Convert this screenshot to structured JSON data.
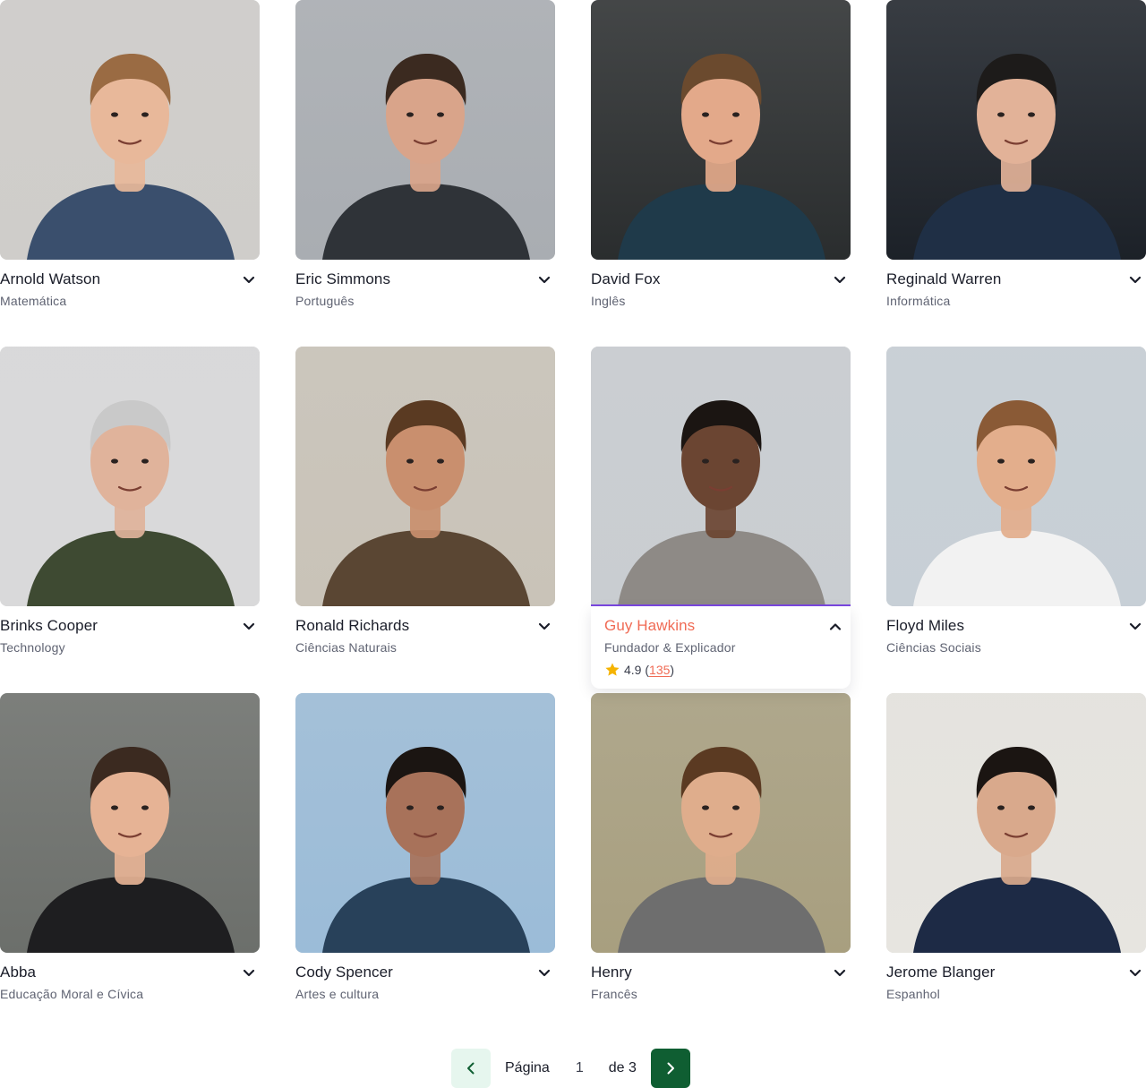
{
  "tutors": [
    {
      "name": "Arnold Watson",
      "subject": "Matemática",
      "bg": "#cfcdca",
      "skin": "#e8b89a",
      "hair": "#9a6b43",
      "shirt": "#3a4f6d"
    },
    {
      "name": "Eric Simmons",
      "subject": "Português",
      "bg": "#a9adb2",
      "skin": "#d9a48a",
      "hair": "#3b2a20",
      "shirt": "#2f3338"
    },
    {
      "name": "David Fox",
      "subject": "Inglês",
      "bg": "#2a2d2e",
      "skin": "#e3a98a",
      "hair": "#6b4a2e",
      "shirt": "#1f3a4a"
    },
    {
      "name": "Reginald Warren",
      "subject": "Informática",
      "bg": "#1c2128",
      "skin": "#e2b298",
      "hair": "#1d1b1a",
      "shirt": "#1f2f45"
    },
    {
      "name": "Brinks Cooper",
      "subject": "Technology",
      "bg": "#d9d9da",
      "skin": "#e0b39b",
      "hair": "#c9c9c9",
      "shirt": "#3e4a32"
    },
    {
      "name": "Ronald Richards",
      "subject": "Ciências Naturais",
      "bg": "#c9c3b8",
      "skin": "#c98f6e",
      "hair": "#5a3a22",
      "shirt": "#5a4633"
    },
    {
      "name": "Guy Hawkins",
      "subject": "Fundador & Explicador",
      "bg": "#c9cdd1",
      "skin": "#6b4532",
      "hair": "#1b1512",
      "shirt": "#8e8a86",
      "expanded": true,
      "rating": "4.9",
      "reviews": "135"
    },
    {
      "name": "Floyd Miles",
      "subject": "Ciências Sociais",
      "bg": "#c7cfd6",
      "skin": "#e3ae8c",
      "hair": "#8a5a36",
      "shirt": "#f2f2f2"
    },
    {
      "name": "Abba",
      "subject": "Educação Moral e Cívica",
      "bg": "#6c6f6b",
      "skin": "#e6b395",
      "hair": "#3b2a20",
      "shirt": "#1e1e20"
    },
    {
      "name": "Cody Spencer",
      "subject": "Artes e cultura",
      "bg": "#9bbcd8",
      "skin": "#a8725a",
      "hair": "#1b1512",
      "shirt": "#28415a"
    },
    {
      "name": "Henry",
      "subject": "Francês",
      "bg": "#a89f7f",
      "skin": "#dfad8c",
      "hair": "#5b3a22",
      "shirt": "#6e6e6e"
    },
    {
      "name": "Jerome Blanger",
      "subject": "Espanhol",
      "bg": "#e7e5e0",
      "skin": "#d9a98c",
      "hair": "#1b1512",
      "shirt": "#1d2a45"
    }
  ],
  "pagination": {
    "page_word": "Página",
    "current": "1",
    "of_label": "de 3"
  },
  "colors": {
    "accent_orange": "#f06b55",
    "accent_purple": "#7a47e0",
    "next_green": "#0f5e32",
    "prev_mint": "#e6f6ee",
    "star_yellow": "#f5b301"
  },
  "icons": {
    "collapsed": "chevron-down-icon",
    "expanded": "chevron-up-icon",
    "rating": "star-icon",
    "prev": "chevron-left-icon",
    "next": "chevron-right-icon"
  }
}
